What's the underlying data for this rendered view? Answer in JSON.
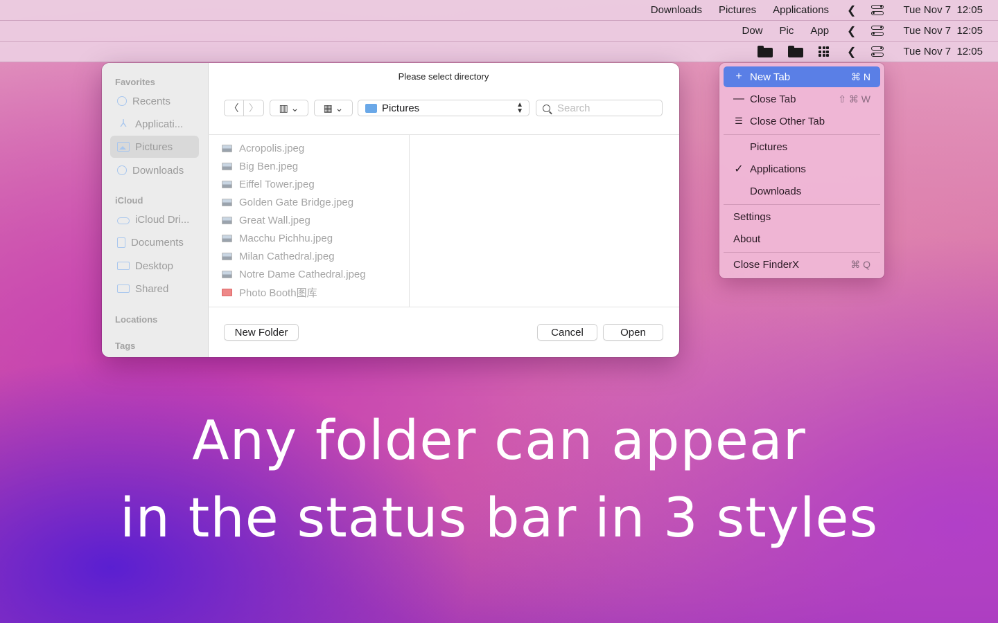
{
  "menubars": [
    {
      "items": [
        "Downloads",
        "Pictures",
        "Applications"
      ],
      "date": "Tue Nov 7",
      "time": "12:05"
    },
    {
      "items": [
        "Dow",
        "Pic",
        "App"
      ],
      "date": "Tue Nov 7",
      "time": "12:05"
    },
    {
      "icons": [
        "folder-icon",
        "folder-icon",
        "grid-icon"
      ],
      "date": "Tue Nov 7",
      "time": "12:05"
    }
  ],
  "dialog": {
    "title": "Please select directory",
    "sidebar": {
      "favorites_label": "Favorites",
      "favorites": [
        "Recents",
        "Applicati...",
        "Pictures",
        "Downloads"
      ],
      "icloud_label": "iCloud",
      "icloud": [
        "iCloud Dri...",
        "Documents",
        "Desktop",
        "Shared"
      ],
      "locations_label": "Locations",
      "tags_label": "Tags",
      "selected": "Pictures"
    },
    "path": "Pictures",
    "search_placeholder": "Search",
    "files": [
      "Acropolis.jpeg",
      "Big Ben.jpeg",
      "Eiffel Tower.jpeg",
      "Golden Gate Bridge.jpeg",
      "Great Wall.jpeg",
      "Macchu Pichhu.jpeg",
      "Milan Cathedral.jpeg",
      "Notre Dame Cathedral.jpeg",
      "Photo Booth图库"
    ],
    "buttons": {
      "new_folder": "New Folder",
      "cancel": "Cancel",
      "open": "Open"
    }
  },
  "menu": {
    "new_tab": "New Tab",
    "new_tab_sc": "⌘ N",
    "close_tab": "Close Tab",
    "close_tab_sc": "⇧ ⌘ W",
    "close_other": "Close Other Tab",
    "folders": [
      "Pictures",
      "Applications",
      "Downloads"
    ],
    "checked": "Applications",
    "settings": "Settings",
    "about": "About",
    "quit": "Close FinderX",
    "quit_sc": "⌘ Q"
  },
  "headline": {
    "line1": "Any folder can appear",
    "line2": "in the status bar in 3 styles"
  }
}
